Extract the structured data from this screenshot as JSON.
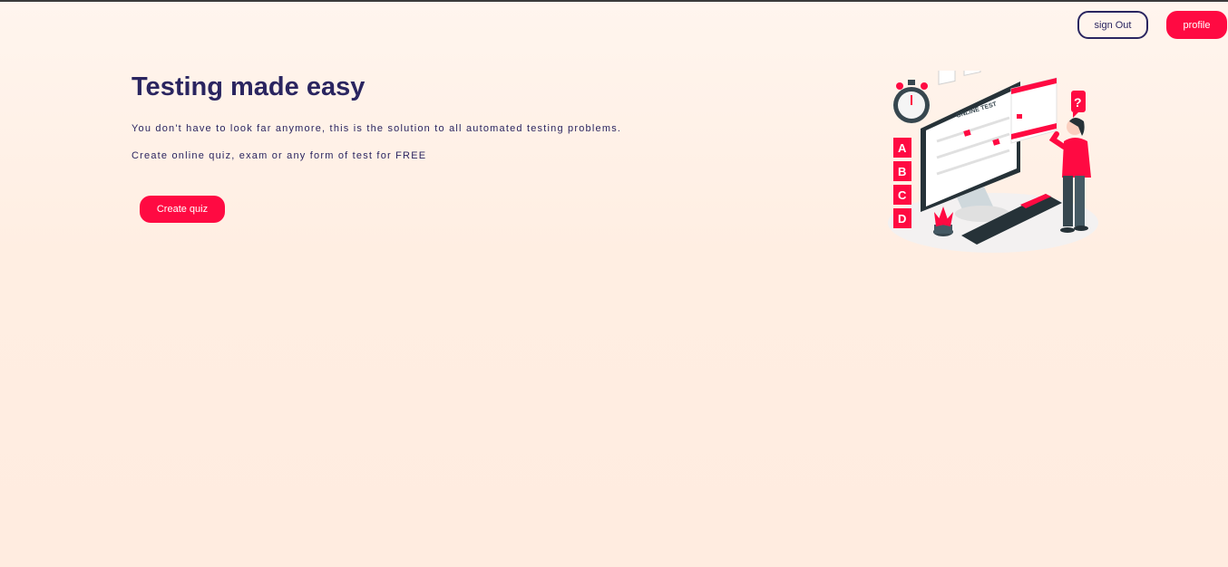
{
  "header": {
    "sign_out_label": "sign Out",
    "profile_label": "profile"
  },
  "hero": {
    "title": "Testing made easy",
    "description_line1": "You don't have to look far anymore, this is the solution to all automated testing problems.",
    "description_line2": "Create online quiz, exam or any form of test for FREE",
    "cta_label": "Create quiz"
  },
  "illustration": {
    "screen_heading": "ONLINE TEST",
    "answer_letters": [
      "A",
      "B",
      "C",
      "D"
    ],
    "question_mark": "?"
  },
  "colors": {
    "accent": "#ff0a42",
    "primary_text": "#2a2560",
    "background": "#fff1e6"
  }
}
